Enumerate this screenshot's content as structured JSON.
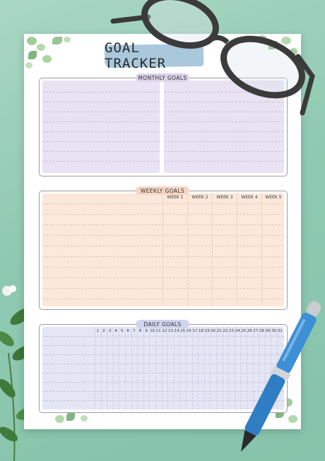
{
  "title": "GOAL TRACKER",
  "monthly": {
    "label": "MONTHLY GOALS"
  },
  "weekly": {
    "label": "WEEKLY GOALS",
    "columns": [
      "WEEK 1",
      "WEEK 2",
      "WEEK 3",
      "WEEK 4",
      "WEEK 5"
    ]
  },
  "daily": {
    "label": "DAILY GOALS",
    "days": [
      "1",
      "2",
      "3",
      "4",
      "5",
      "6",
      "7",
      "8",
      "9",
      "10",
      "11",
      "12",
      "13",
      "14",
      "15",
      "16",
      "17",
      "18",
      "19",
      "20",
      "21",
      "22",
      "23",
      "24",
      "25",
      "26",
      "27",
      "28",
      "29",
      "30",
      "31"
    ]
  },
  "colors": {
    "background": "#94ccb5",
    "title_highlight": "#a9c8dc",
    "monthly_fill": "#e8e2f2",
    "monthly_badge": "#ddd3ea",
    "weekly_fill": "#fce8da",
    "weekly_badge": "#f5d6c4",
    "daily_fill": "#e4e6f5",
    "daily_badge": "#cfd5ee"
  },
  "icons": [
    "eyeglasses-icon",
    "fountain-pen-icon",
    "eucalyptus-leaves-icon",
    "white-flower-icon"
  ]
}
